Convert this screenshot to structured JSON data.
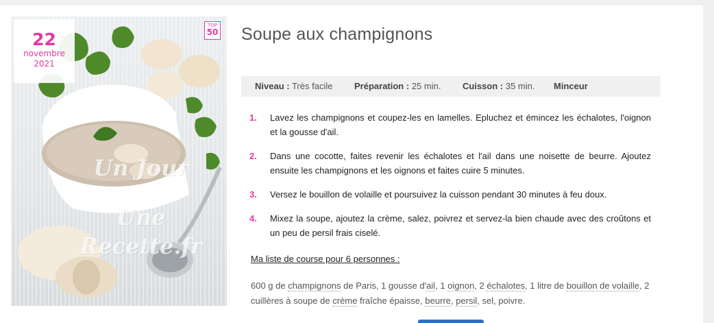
{
  "recipe": {
    "title": "Soupe aux champignons",
    "date": {
      "day": "22",
      "month": "novembre",
      "year": "2021"
    },
    "badge": {
      "top_label": "TOP",
      "top_number": "50"
    },
    "watermark": [
      "Un Jour",
      "Une Recette.fr"
    ],
    "info": {
      "niveau_label": "Niveau :",
      "niveau_value": "Très facile",
      "preparation_label": "Préparation :",
      "preparation_value": "25 min.",
      "cuisson_label": "Cuisson :",
      "cuisson_value": "35 min.",
      "tag": "Minceur"
    },
    "steps": [
      {
        "num": "1.",
        "text": "Lavez les champignons et coupez-les en lamelles. Epluchez et émincez les échalotes, l'oignon et la gousse d'ail."
      },
      {
        "num": "2.",
        "text": "Dans une cocotte, faites revenir les échalotes et l'ail dans une noisette de beurre. Ajoutez ensuite les champignons et les oignons et faites cuire 5 minutes."
      },
      {
        "num": "3.",
        "text": "Versez le bouillon de volaille et poursuivez la cuisson pendant 30 minutes à feu doux."
      },
      {
        "num": "4.",
        "text": "Mixez la soupe, ajoutez la crème, salez, poivrez et servez-la bien chaude avec des croûtons et un peu de persil frais ciselé."
      }
    ],
    "shopping": {
      "title": "Ma liste de course pour 6 personnes :",
      "t0": "600 g de ",
      "l_champignons": "champignons",
      "t1": " de Paris, 1 gousse d'",
      "l_ail": "ail",
      "t2": ", 1 ",
      "l_oignon": "oignon",
      "t3": ", 2 ",
      "l_echalotes": "échalotes",
      "t4": ", 1 litre de ",
      "l_bouillon": "bouillon de volaille",
      "t5": ", 2 cuillères à soupe de ",
      "l_creme": "crème",
      "t6": " fraîche épaisse, ",
      "l_beurre": "beurre",
      "t7": ", ",
      "l_persil": "persil",
      "t8": ", sel, poivre."
    }
  },
  "colors": {
    "accent": "#e23aa3",
    "infobar_bg": "#f0f0f0"
  }
}
